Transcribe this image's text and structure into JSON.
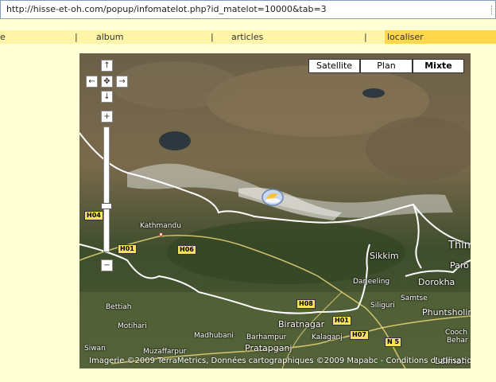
{
  "browser": {
    "url": "http://hisse-et-oh.com/popup/infomatelot.php?id_matelot=10000&tab=3"
  },
  "nav": {
    "tabs": [
      {
        "label": "e"
      },
      {
        "label": "album"
      },
      {
        "label": "articles"
      },
      {
        "label": "localiser"
      }
    ],
    "separator": "|"
  },
  "map": {
    "types": {
      "satellite": "Satellite",
      "plan": "Plan",
      "mixte": "Mixte"
    },
    "selected_type": "Mixte",
    "controls": {
      "up": "↑",
      "left": "←",
      "center": "✥",
      "right": "→",
      "down": "↓",
      "zoom_in": "+",
      "zoom_out": "−"
    },
    "places": {
      "kathmandu": "Kathmandu",
      "sikkim": "Sikkim",
      "thim": "Thim",
      "paro": "Paro",
      "dorokha": "Dorokha",
      "darjeeling": "Darjeeling",
      "samtse": "Samtse",
      "siliguri": "Siliguri",
      "phuntsholing": "Phuntsholing",
      "cooch": "Cooch",
      "behar": "Behar",
      "bettiah": "Bettiah",
      "motihari": "Motihari",
      "siwan": "Siwan",
      "muzaffarpur": "Muzaffarpur",
      "madhubani": "Madhubani",
      "barhampur": "Barhampur",
      "biratnagar": "Biratnagar",
      "kalaganj": "Kalaganj",
      "pratapganj": "Pratapganj",
      "lalmani": "Lalmani"
    },
    "highways": {
      "h04": "H04",
      "h01a": "H01",
      "h06": "H06",
      "h08": "H08",
      "h01b": "H01",
      "h07": "H07",
      "n5": "N 5"
    },
    "attribution": "Imagerie ©2009 TerraMetrics, Données cartographiques ©2009 Mapabc -",
    "terms_link": "Conditions d'utilisation"
  }
}
